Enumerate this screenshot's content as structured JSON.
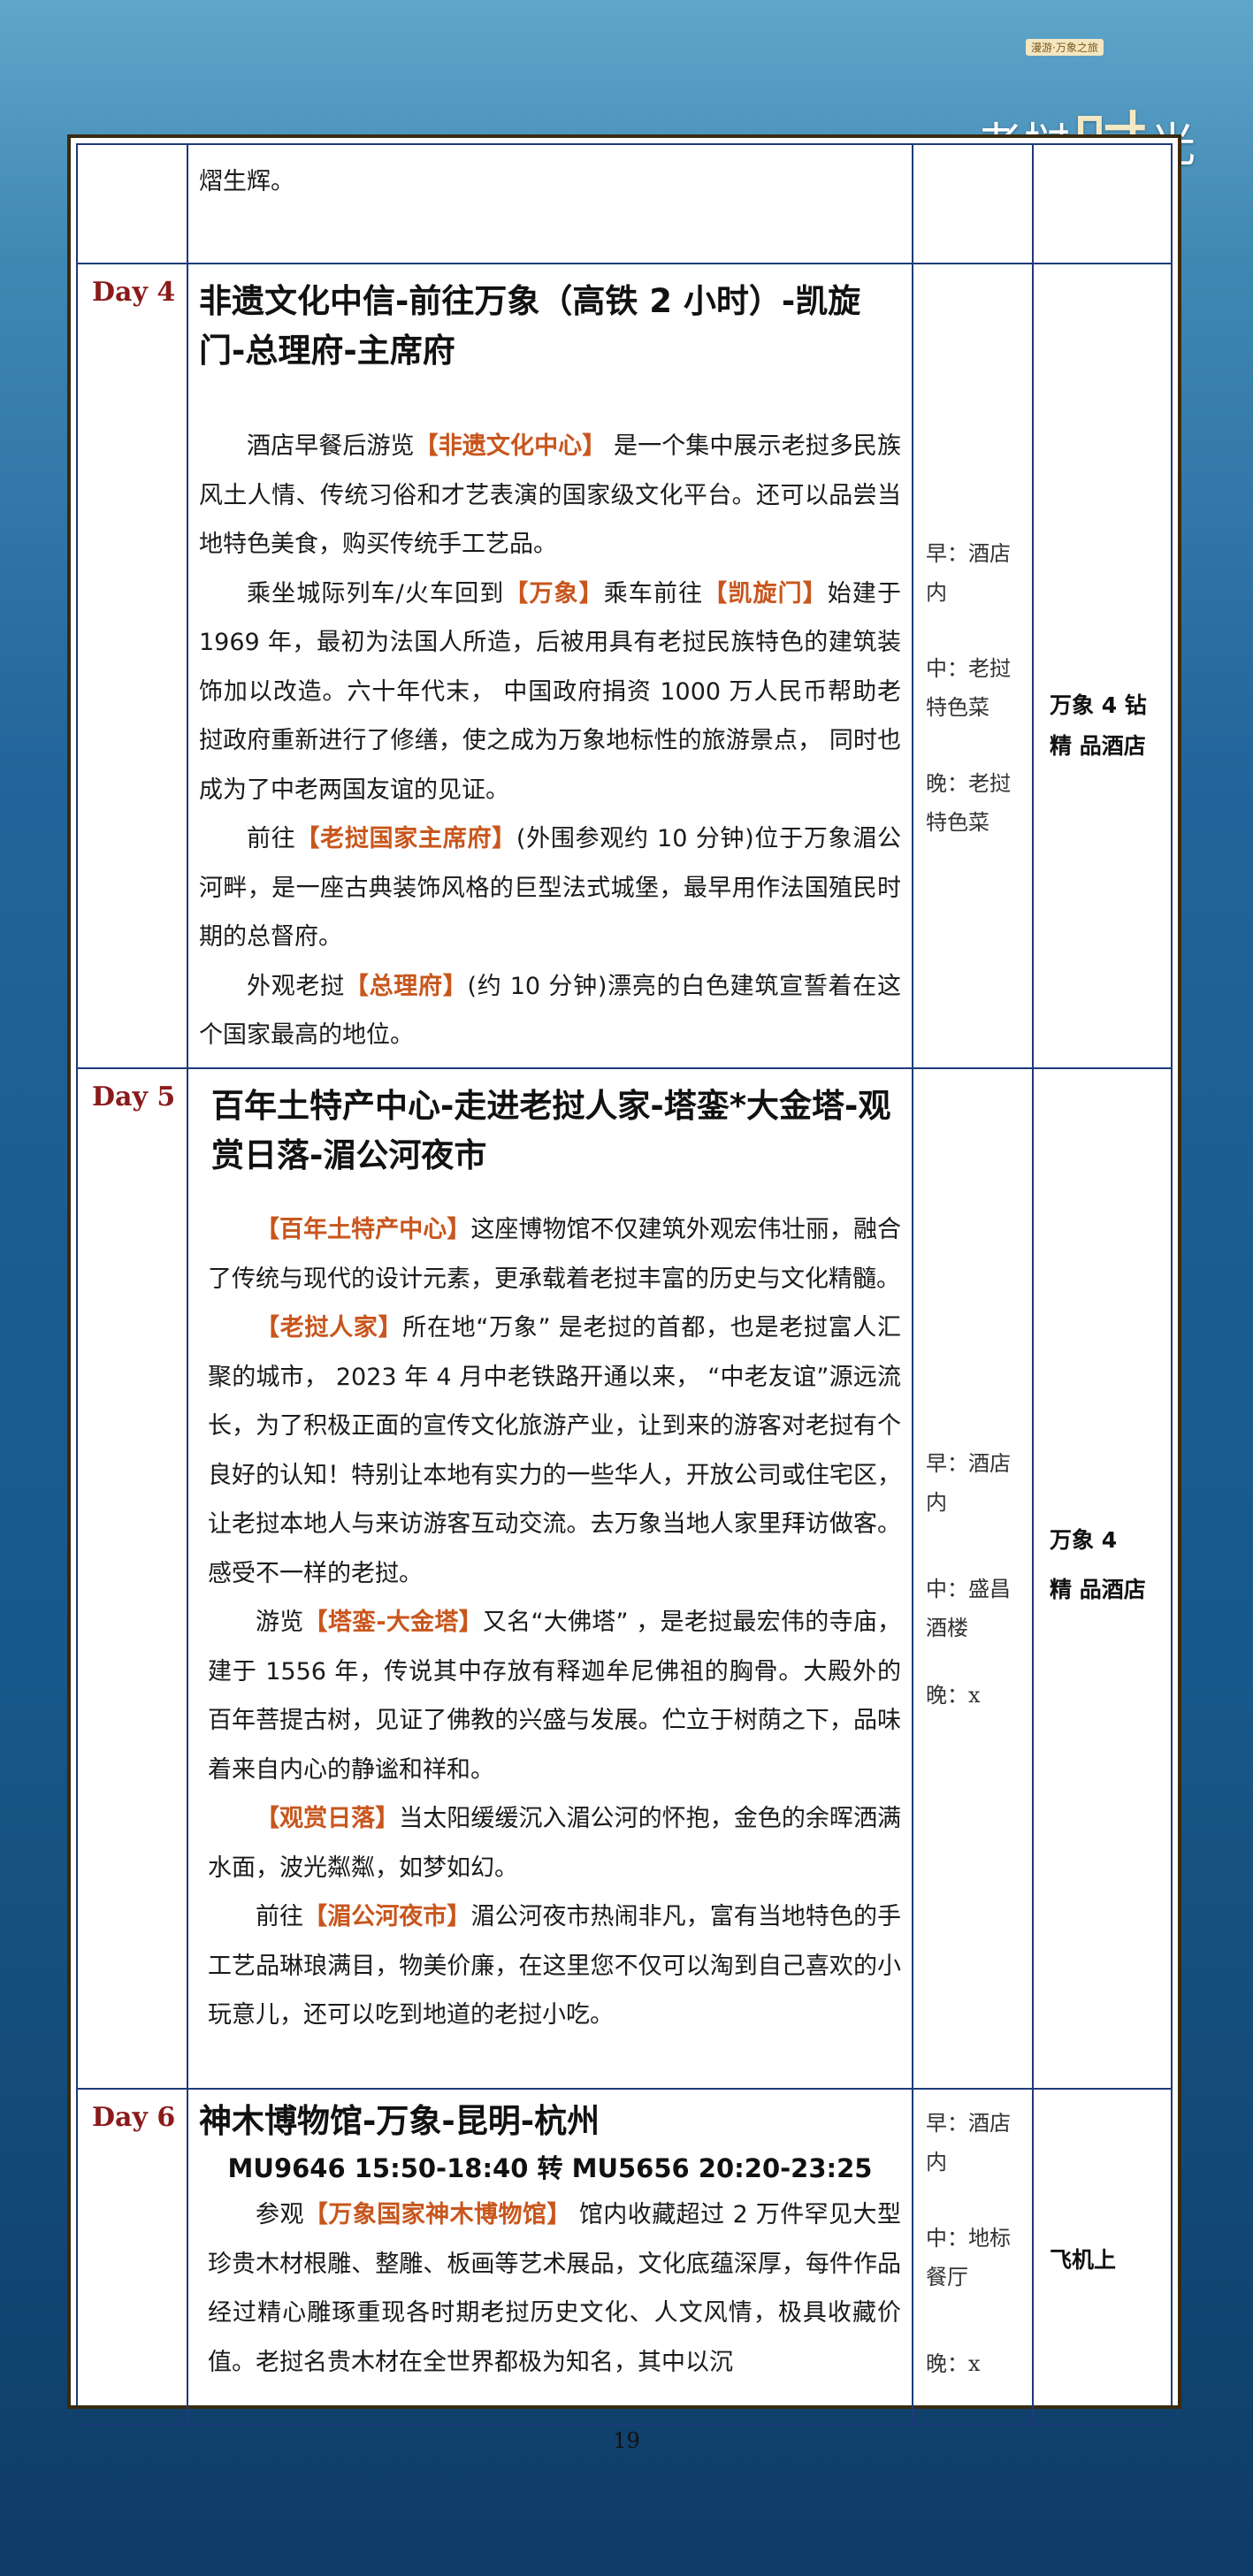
{
  "logo": {
    "tag": "漫游·万象之旅",
    "text_a": "老挝",
    "text_b": "时",
    "text_c": "光"
  },
  "row0": {
    "text": "熠生辉。"
  },
  "day4": {
    "day": "Day 4",
    "title": "非遗文化中信-前往万象（高铁 2 小时）-凯旋门-总理府-主席府",
    "p1": [
      {
        "t": "酒店早餐后游览"
      },
      {
        "t": "【非遗文化中心】",
        "hl": true
      },
      {
        "t": "  是一个集中展示老挝多民族风土人情、传统习俗和才艺表演的国家级文化平台。还可以品尝当地特色美食，购买传统手工艺品。"
      }
    ],
    "p2": [
      {
        "t": "乘坐城际列车/火车回到"
      },
      {
        "t": "【万象】",
        "hl": true
      },
      {
        "t": "乘车前往"
      },
      {
        "t": "【凯旋门】",
        "hl": true
      },
      {
        "t": "始建于 1969 年，最初为法国人所造，后被用具有老挝民族特色的建筑装饰加以改造。六十年代末， 中国政府捐资  1000 万人民币帮助老挝政府重新进行了修缮，使之成为万象地标性的旅游景点， 同时也成为了中老两国友谊的见证。"
      }
    ],
    "p3": [
      {
        "t": "前往"
      },
      {
        "t": "【老挝国家主席府】",
        "hl": true
      },
      {
        "t": "(外围参观约  10  分钟)位于万象湄公河畔，是一座古典装饰风格的巨型法式城堡，最早用作法国殖民时期的总督府。"
      }
    ],
    "p4": [
      {
        "t": "外观老挝"
      },
      {
        "t": "【总理府】",
        "hl": true
      },
      {
        "t": "(约  10  分钟)漂亮的白色建筑宣誓着在这个国家最高的地位。"
      }
    ],
    "meals": {
      "breakfast": "早：酒店内",
      "lunch": "中：老挝特色菜",
      "dinner": "晚：老挝特色菜"
    },
    "hotel": "万象 4 钻精 品酒店"
  },
  "day5": {
    "day": "Day 5",
    "title": "百年土特产中心-走进老挝人家-塔銮*大金塔-观赏日落-湄公河夜市",
    "p1": [
      {
        "t": "【百年土特产中心】",
        "hl": true
      },
      {
        "t": "这座博物馆不仅建筑外观宏伟壮丽，融合了传统与现代的设计元素，更承载着老挝丰富的历史与文化精髓。"
      }
    ],
    "p2": [
      {
        "t": "【老挝人家】",
        "hl": true
      },
      {
        "t": "所在地“万象”  是老挝的首都，也是老挝富人汇聚的城市， 2023  年  4  月中老铁路开通以来， “中老友谊”源远流长，为了积极正面的宣传文化旅游产业，让到来的游客对老挝有个良好的认知！特别让本地有实力的一些华人，开放公司或住宅区，让老挝本地人与来访游客互动交流。去万象当地人家里拜访做客。感受不一样的老挝。"
      }
    ],
    "p3": [
      {
        "t": "游览"
      },
      {
        "t": "【塔銮-大金塔】",
        "hl": true
      },
      {
        "t": "又名“大佛塔” ，是老挝最宏伟的寺庙，建于  1556  年，传说其中存放有释迦牟尼佛祖的胸骨。大殿外的百年菩提古树，见证了佛教的兴盛与发展。伫立于树荫之下，品味着来自内心的静谧和祥和。"
      }
    ],
    "p4": [
      {
        "t": "【观赏日落】",
        "hl": true
      },
      {
        "t": "当太阳缓缓沉入湄公河的怀抱，金色的余晖洒满水面，波光粼粼，如梦如幻。"
      }
    ],
    "p5": [
      {
        "t": "前往"
      },
      {
        "t": "【湄公河夜市】",
        "hl": true
      },
      {
        "t": "湄公河夜市热闹非凡，富有当地特色的手工艺品琳琅满目，物美价廉，在这里您不仅可以淘到自己喜欢的小玩意儿，还可以吃到地道的老挝小吃。"
      }
    ],
    "meals": {
      "breakfast": "早：酒店内",
      "lunch": "中：盛昌酒楼",
      "dinner": "晚：x"
    },
    "hotel_a": "万象 4",
    "hotel_b": "精 品酒店"
  },
  "day6": {
    "day": "Day 6",
    "title": "神木博物馆-万象-昆明-杭州",
    "flight": "MU9646 15:50-18:40 转 MU5656 20:20-23:25",
    "p1": [
      {
        "t": "参观"
      },
      {
        "t": "【万象国家神木博物馆】",
        "hl": true
      },
      {
        "t": " 馆内收藏超过 2 万件罕见大型珍贵木材根雕、整雕、板画等艺术展品，文化底蕴深厚，每件作品经过精心雕琢重现各时期老挝历史文化、人文风情，极具收藏价值。老挝名贵木材在全世界都极为知名，其中以沉"
      }
    ],
    "meals": {
      "breakfast": "早：酒店内",
      "lunch": "中：地标餐厅",
      "dinner": "晚：x"
    },
    "hotel": "飞机上"
  },
  "page_number": "19"
}
